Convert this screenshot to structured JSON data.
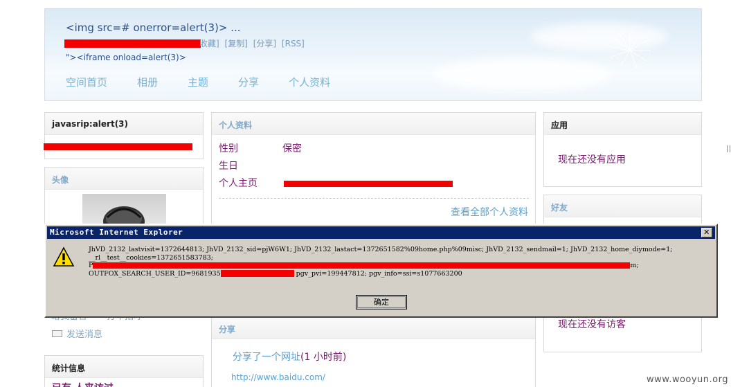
{
  "header": {
    "space_title": "<img src=# onerror=alert(3)> ...",
    "links": [
      "收藏]",
      "[复制]",
      "[分享]",
      "[RSS]"
    ],
    "sub_line": "\"><iframe onload=alert(3)>",
    "nav": [
      "空间首页",
      "相册",
      "主题",
      "分享",
      "个人资料"
    ]
  },
  "left": {
    "user_panel_title": "javasrip:alert(3)",
    "avatar_panel_title": "头像",
    "action_1": "给我留言",
    "action_2": "打个招呼",
    "send_message": "发送消息",
    "stats_title": "统计信息",
    "stats_line": "已有 人来访过"
  },
  "profile": {
    "title": "个人资料",
    "rows": [
      {
        "label": "性别",
        "value": "保密"
      },
      {
        "label": "生日",
        "value": ""
      },
      {
        "label": "个人主页",
        "value": ""
      }
    ],
    "view_all": "查看全部个人资料"
  },
  "share": {
    "title": "分享",
    "item": "分享了一个网址",
    "time": "(1 小时前)",
    "url": "http://www.baidu.com/"
  },
  "right": {
    "apps_title": "应用",
    "apps_empty": "现在还没有应用",
    "friends_title": "好友",
    "visitors_empty": "现在还没有访客"
  },
  "dialog": {
    "title": "Microsoft Internet Explorer",
    "icon": "warning-icon",
    "line1": "JhVD_2132_lastvisit=1372644813; JhVD_2132_sid=pjW6W1; JhVD_2132_lastact=1372651582%09home.php%09misc; JhVD_2132_sendmail=1; JhVD_2132_home_diymode=1;",
    "line2": "__rl__test__cookies=1372651583783;",
    "line3_prefix": "P",
    "line3_suffix": "m;",
    "line4_prefix": "OUTFOX_SEARCH_USER_ID=9681935",
    "line4_suffix": "pgv_pvi=199447812; pgv_info=ssi=s1077663200",
    "ok_label": "确定"
  },
  "watermark": "www.wooyun.org",
  "colors": {
    "nav": "#79b3d3",
    "purple": "#7a1b6e",
    "link_blue": "#5aa0cc",
    "redaction": "#f30000",
    "dialog_title_bg": "#0a246a"
  }
}
